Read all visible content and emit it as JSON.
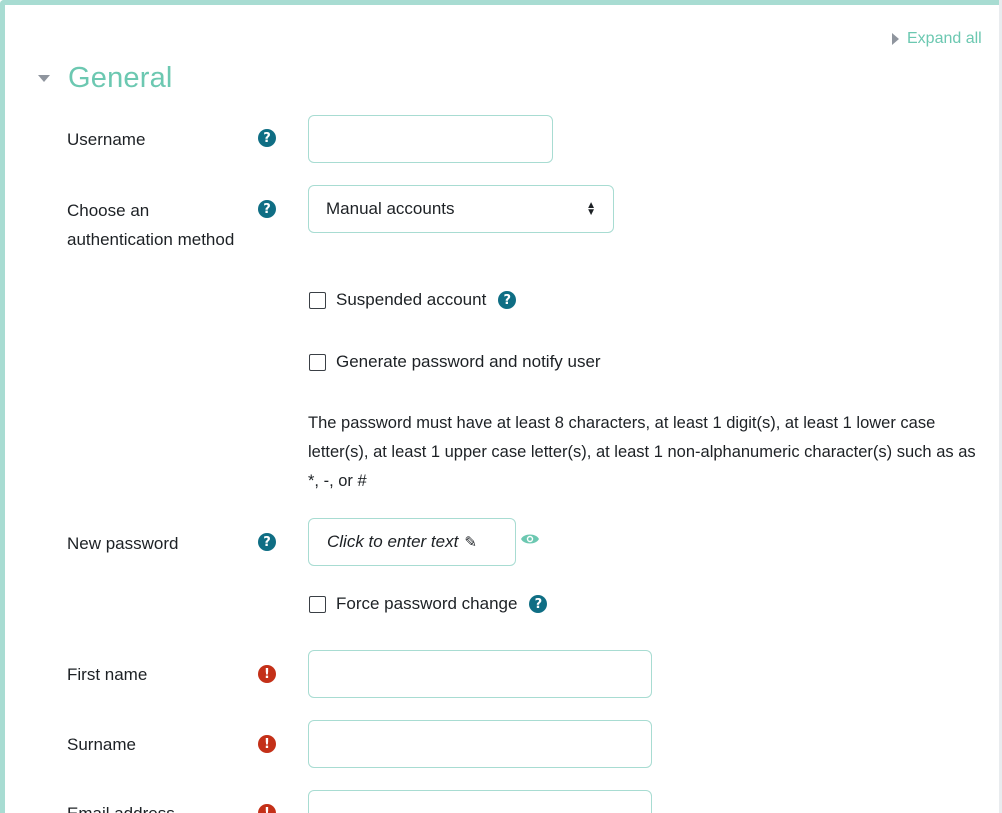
{
  "header": {
    "expand_all": "Expand all"
  },
  "section": {
    "title": "General"
  },
  "fields": {
    "username": {
      "label": "Username",
      "value": ""
    },
    "auth": {
      "label_line1": "Choose an",
      "label_line2": "authentication method",
      "selected": "Manual accounts"
    },
    "suspended": {
      "label": "Suspended account"
    },
    "generate_pw": {
      "label": "Generate password and notify user"
    },
    "policy_text": "The password must have at least 8 characters, at least 1 digit(s), at least 1 lower case letter(s), at least 1 upper case letter(s), at least 1 non-alphanumeric character(s) such as as *, -, or #",
    "new_password": {
      "label": "New password",
      "placeholder": "Click to enter text"
    },
    "force_change": {
      "label": "Force password change"
    },
    "first_name": {
      "label": "First name",
      "value": ""
    },
    "surname": {
      "label": "Surname",
      "value": ""
    },
    "email": {
      "label": "Email address",
      "value": ""
    }
  },
  "icons": {
    "help": "question-circle-icon",
    "required": "exclamation-circle-icon",
    "reveal": "eye-icon",
    "edit": "pencil-icon"
  },
  "colors": {
    "accent": "#6cc8b1",
    "border": "#a8dcd2",
    "help": "#0f6e84",
    "required": "#c43018"
  }
}
